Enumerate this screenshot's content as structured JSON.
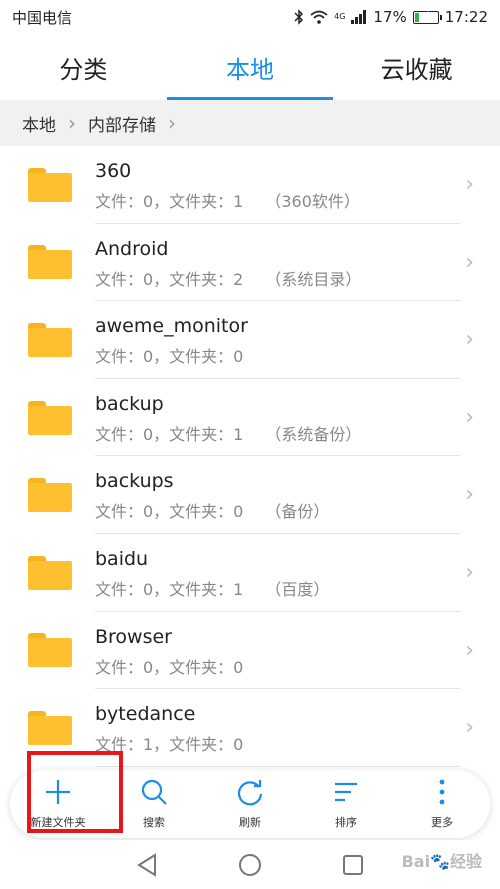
{
  "status": {
    "carrier": "中国电信",
    "network": "4G",
    "battery": "17%",
    "battery_level": 0.17,
    "time": "17:22"
  },
  "tabs": [
    {
      "label": "分类",
      "active": false
    },
    {
      "label": "本地",
      "active": true
    },
    {
      "label": "云收藏",
      "active": false
    }
  ],
  "breadcrumb": [
    "本地",
    "内部存储"
  ],
  "folders": [
    {
      "name": "360",
      "detail": "文件：0，文件夹：1",
      "note": "（360软件）"
    },
    {
      "name": "Android",
      "detail": "文件：0，文件夹：2",
      "note": "（系统目录）"
    },
    {
      "name": "aweme_monitor",
      "detail": "文件：0，文件夹：0",
      "note": ""
    },
    {
      "name": "backup",
      "detail": "文件：0，文件夹：1",
      "note": "（系统备份）"
    },
    {
      "name": "backups",
      "detail": "文件：0，文件夹：0",
      "note": "（备份）"
    },
    {
      "name": "baidu",
      "detail": "文件：0，文件夹：1",
      "note": "（百度）"
    },
    {
      "name": "Browser",
      "detail": "文件：0，文件夹：0",
      "note": ""
    },
    {
      "name": "bytedance",
      "detail": "文件：1，文件夹：0",
      "note": ""
    }
  ],
  "toolbar": [
    {
      "label": "新建文件夹",
      "icon": "plus-icon"
    },
    {
      "label": "搜索",
      "icon": "search-icon"
    },
    {
      "label": "刷新",
      "icon": "refresh-icon"
    },
    {
      "label": "排序",
      "icon": "sort-icon"
    },
    {
      "label": "更多",
      "icon": "more-icon"
    }
  ],
  "watermark": "Bai🐾经验",
  "colors": {
    "accent": "#1a8fe3",
    "folder": "#fec02f",
    "highlight": "#e8151b"
  }
}
